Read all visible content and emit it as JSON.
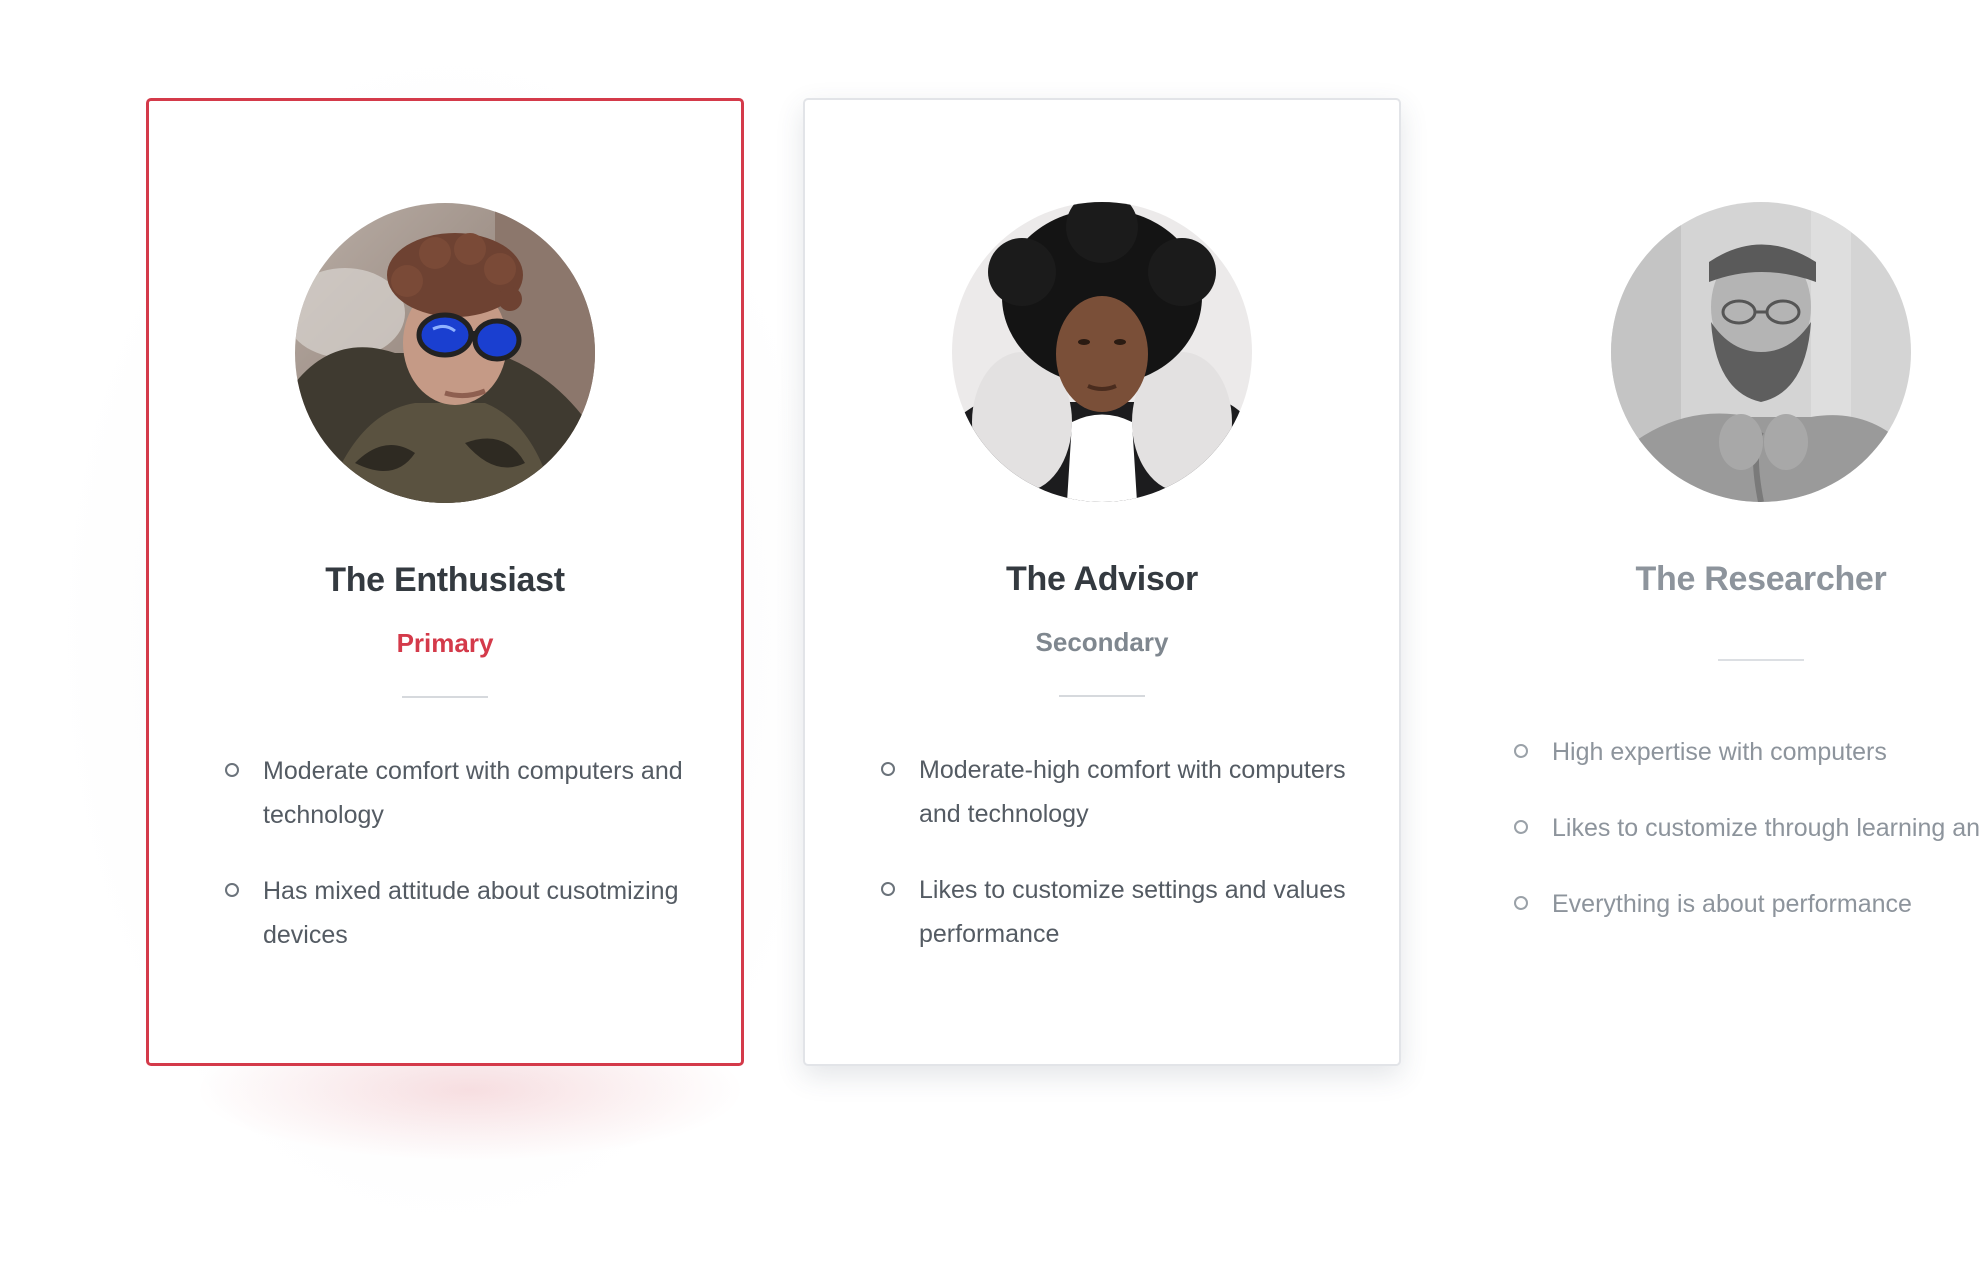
{
  "personas": [
    {
      "name": "The Enthusiast",
      "role": "Primary",
      "traits": [
        "Moderate comfort with computers and technology",
        "Has mixed attitude about cusotmizing devices"
      ],
      "photo": "person-with-blue-sunglasses-photo"
    },
    {
      "name": "The Advisor",
      "role": "Secondary",
      "traits": [
        "Moderate-high comfort with computers and technology",
        "Likes to customize settings and values performance"
      ],
      "photo": "person-with-fur-hood-photo"
    },
    {
      "name": "The Researcher",
      "role": "",
      "traits": [
        "High expertise with computers",
        "Likes to customize through learning and research",
        "Everything is about performance"
      ],
      "photo": "bearded-person-with-glasses-photo"
    }
  ],
  "colors": {
    "accent": "#d43a4a",
    "heading": "#343a40",
    "muted": "#8d949c",
    "body_text": "#545b63"
  },
  "icons": {
    "bullet": "circle-bullet-icon"
  }
}
